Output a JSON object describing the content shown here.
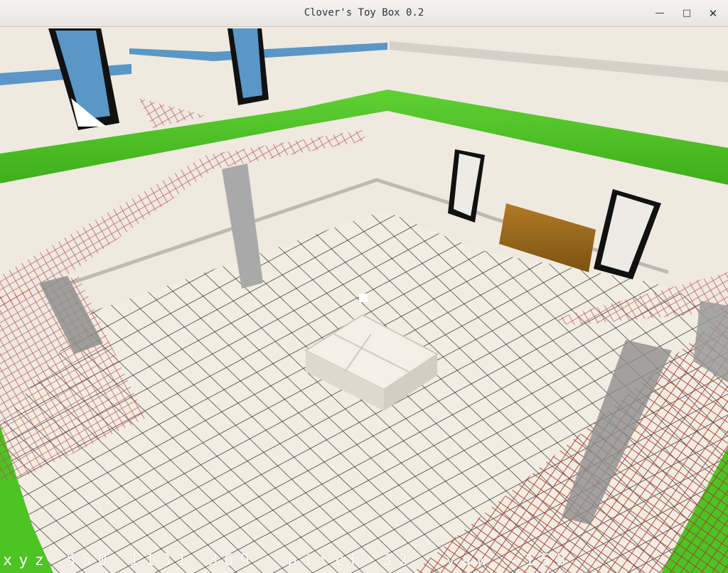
{
  "window": {
    "title": "Clover's Toy Box 0.2",
    "minimize_symbol": "—",
    "maximize_symbol": "□",
    "close_symbol": "✕"
  },
  "hud": {
    "text": "xyz 550 1131 369  pitch 32  yaw -153"
  },
  "scene": {
    "colors": {
      "wall": "#efe9e0",
      "floor": "#f1ece2",
      "grass": "#4cc424",
      "water": "#5a97c6",
      "mesh": "#b5474a",
      "pillar": "#a9a9a9",
      "crate": "#9a6a1c",
      "frame": "#111111"
    },
    "icons": {
      "minimize": "minimize-icon",
      "maximize": "maximize-icon",
      "close": "close-icon"
    }
  }
}
